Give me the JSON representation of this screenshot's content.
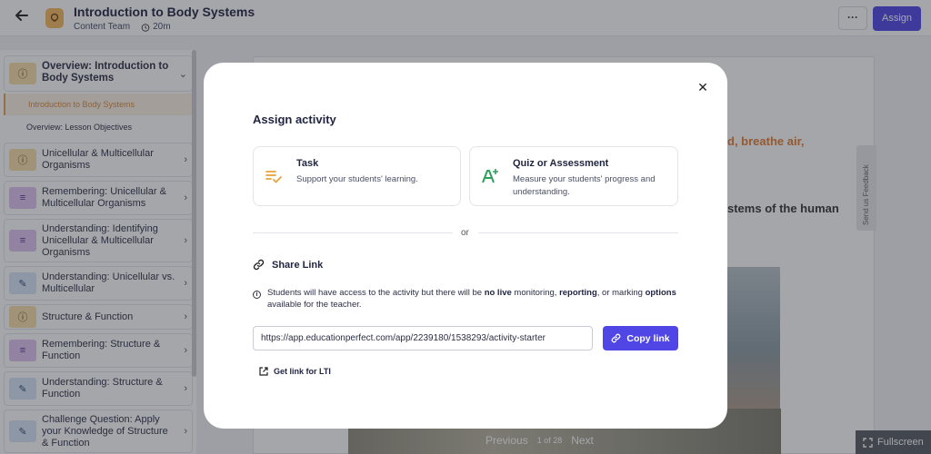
{
  "header": {
    "back_icon": "arrow-left-icon",
    "course_icon": "lightbulb-icon",
    "title": "Introduction to Body Systems",
    "author": "Content Team",
    "duration": "20m",
    "more_label": "···",
    "assign_label": "Assign",
    "accent": "#4f46e5"
  },
  "sidebar": {
    "items": [
      {
        "icon": "info-icon",
        "label": "Overview: Introduction to Body Systems",
        "expanded": true
      },
      {
        "label": "Introduction to Body Systems",
        "active": true
      },
      {
        "label": "Overview: Lesson Objectives"
      },
      {
        "icon": "info-icon",
        "label": "Unicellular & Multicellular Organisms"
      },
      {
        "icon": "list-check-icon",
        "label": "Remembering: Unicellular & Multicellular Organisms"
      },
      {
        "icon": "list-check-icon",
        "label": "Understanding: Identifying Unicellular & Multicellular Organisms"
      },
      {
        "icon": "pencil-icon",
        "label": "Understanding: Unicellular vs. Multicellular"
      },
      {
        "icon": "info-icon",
        "label": "Structure & Function"
      },
      {
        "icon": "list-check-icon",
        "label": "Remembering: Structure & Function"
      },
      {
        "icon": "pencil-icon",
        "label": "Understanding: Structure & Function"
      },
      {
        "icon": "pencil-icon",
        "label": "Challenge Question: Apply your Knowledge of Structure & Function"
      }
    ]
  },
  "content": {
    "orange_text": "d, breathe air,",
    "black_text": "stems of the human",
    "pager": {
      "previous": "Previous",
      "count": "1 of 28",
      "next": "Next"
    },
    "feedback_label": "Send us Feedback",
    "fullscreen_label": "Fullscreen"
  },
  "modal": {
    "title": "Assign activity",
    "close_icon": "close-icon",
    "options": {
      "task": {
        "icon": "task-list-icon",
        "title": "Task",
        "description": "Support your students' learning."
      },
      "quiz": {
        "icon": "grade-a-plus-icon",
        "title": "Quiz or Assessment",
        "description": "Measure your students' progress and understanding."
      }
    },
    "or_label": "or",
    "share": {
      "title": "Share Link",
      "notice_pre": "Students will have access to the activity but there will be ",
      "notice_b1": "no live",
      "notice_mid1": " monitoring, ",
      "notice_b2": "reporting",
      "notice_mid2": ", or marking ",
      "notice_b3": "options",
      "notice_post": " available for the teacher.",
      "url": "https://app.educationperfect.com/app/2239180/1538293/activity-starter",
      "copy_label": "Copy link",
      "lti_label": "Get link for LTI"
    }
  }
}
